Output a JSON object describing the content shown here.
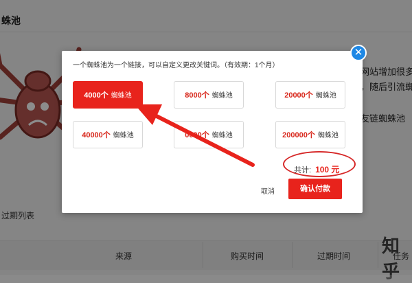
{
  "background": {
    "title": "蛛池",
    "right_texts": [
      "的网站增加很多",
      "接，随后引流蜘",
      "外友链蜘蛛池"
    ],
    "expired_label": "过期列表",
    "table_headers": [
      "来源",
      "购买时间",
      "过期时间",
      "任务"
    ],
    "watermark": "知乎"
  },
  "modal": {
    "description": "一个蜘蛛池为一个链接，可以自定义更改关键词。（有效期：1个月）",
    "close_glyph": "✕",
    "options": [
      {
        "amount": "4000个",
        "unit": "蜘蛛池",
        "selected": true
      },
      {
        "amount": "8000个",
        "unit": "蜘蛛池",
        "selected": false
      },
      {
        "amount": "20000个",
        "unit": "蜘蛛池",
        "selected": false
      },
      {
        "amount": "40000个",
        "unit": "蜘蛛池",
        "selected": false
      },
      {
        "amount": "0000个",
        "unit": "蜘蛛池",
        "selected": false
      },
      {
        "amount": "200000个",
        "unit": "蜘蛛池",
        "selected": false
      }
    ],
    "total_label": "共计:",
    "total_value": "100 元",
    "cancel_label": "取消",
    "pay_label": "确认付款"
  },
  "colors": {
    "accent_red": "#e8231c",
    "close_blue": "#1e88e5",
    "annotation_red": "#d62828"
  }
}
